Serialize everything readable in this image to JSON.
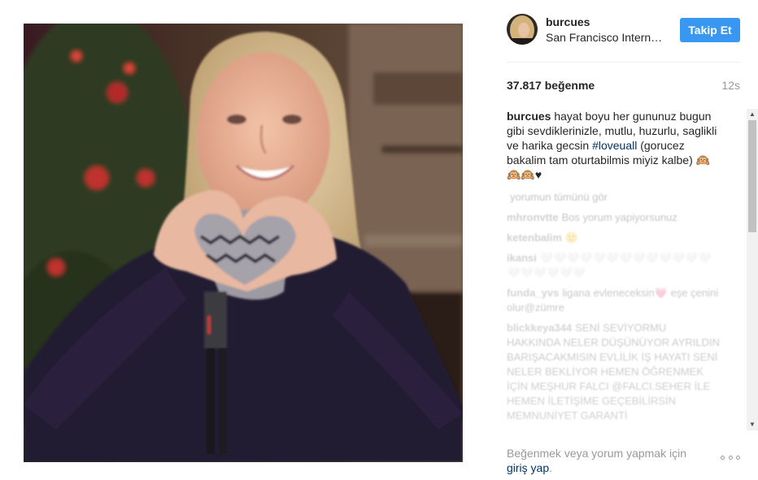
{
  "post": {
    "username": "burcues",
    "location": "San Francisco International Airport",
    "follow_label": "Takip Et",
    "likes": "37.817 beğenme",
    "time": "12s"
  },
  "caption": {
    "username": "burcues",
    "text_before_tag": "hayat boyu her gununuz bugun gibi sevdiklerinizle, mutlu, huzurlu, saglikli ve harika gecsin",
    "hashtag": "#loveuall",
    "text_after_tag": "(gorucez bakalim tam oturtabilmis miyiz kalbe) 🙉🙉🙉♥"
  },
  "comments_faded": [
    {
      "user": "",
      "text": "yorumun tümünü gör"
    },
    {
      "user": "mhronvtte",
      "text": "Bos yorum yapiyorsunuz"
    },
    {
      "user": "ketenbalim",
      "text": "🙂"
    },
    {
      "user": "ikansi",
      "text": "🤍🤍🤍🤍🤍🤍🤍🤍🤍🤍🤍🤍🤍🤍🤍🤍🤍🤍🤍"
    },
    {
      "user": "funda_yvs",
      "text": "ligana evleneceksin💗 eşe çenini olur@zümre"
    },
    {
      "user": "blickkeya344",
      "text": "SENİ SEVİYORMU HAKKINDA NELER DÜŞÜNÜYOR AYRILDIN BARIŞACAKMISIN EVLİLİK İŞ HAYATI SENİ NELER BEKLİYOR HEMEN ÖĞRENMEK İÇİN MEŞHUR FALCI @FALCI.SEHER İLE HEMEN İLETİŞİME GEÇEBİLİRSİN MEMNUNİYET GARANTİ"
    }
  ],
  "footer": {
    "prompt": "Beğenmek veya yorum yapmak için",
    "login_label": "giriş yap",
    "period": "."
  },
  "icons": {
    "more": "more-options-icon",
    "avatar": "avatar"
  },
  "colors": {
    "follow_button": "#3897f0",
    "link": "#003569",
    "muted": "#999999"
  }
}
